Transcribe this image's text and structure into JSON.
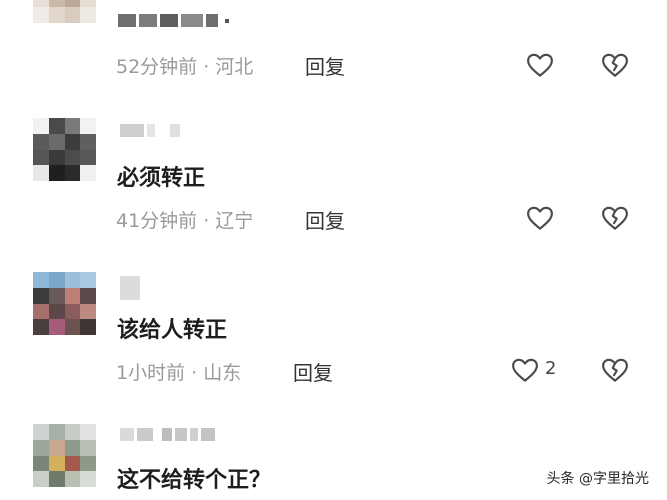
{
  "comments": [
    {
      "text": "",
      "meta": "52分钟前 · 河北",
      "reply_label": "回复",
      "like_count": ""
    },
    {
      "text": "必须转正",
      "meta": "41分钟前 · 辽宁",
      "reply_label": "回复",
      "like_count": ""
    },
    {
      "text": "该给人转正",
      "meta": "1小时前 · 山东",
      "reply_label": "回复",
      "like_count": "2"
    },
    {
      "text": "这不给转个正？",
      "meta": "",
      "reply_label": "",
      "like_count": ""
    }
  ],
  "watermark": "头条 @字里拾光",
  "icons": {
    "like": "heart-outline-icon",
    "dislike": "broken-heart-icon"
  }
}
